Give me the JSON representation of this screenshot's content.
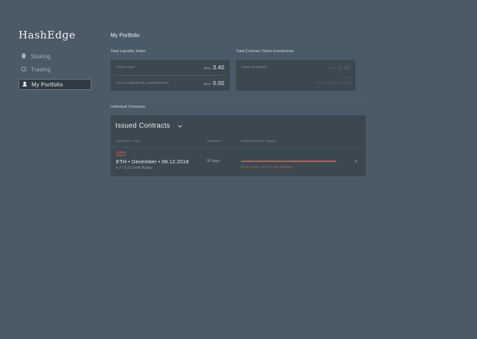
{
  "app": {
    "name": "HashEdge"
  },
  "nav": {
    "items": [
      {
        "label": "Staking",
        "icon": "document-icon"
      },
      {
        "label": "Trading",
        "icon": "globe-icon"
      },
      {
        "label": "My Portfolio",
        "icon": "user-icon",
        "active": true
      }
    ]
  },
  "page": {
    "title": "My Portfolio"
  },
  "liquidity": {
    "section_label": "Total Liquidity Stake",
    "rows": [
      {
        "label": "TOTAL STAKE",
        "currency": "ETH",
        "value": "3.40"
      },
      {
        "label": "TOTAL CUMULATIVE DIVIDENDS PAID",
        "currency": "ETH",
        "value": "0.00"
      }
    ]
  },
  "investments": {
    "section_label": "Total Contract Token Investments",
    "holdings_label": "TOTAL HOLDINGS",
    "currency": "ETH",
    "value": "0.00",
    "note_top": "HOLD",
    "note_bottom": "Collective staking at ETH Stake"
  },
  "contracts": {
    "section_label": "Individual Contracts",
    "dropdown_label": "Issued Contracts",
    "columns": [
      "CONTRACT TITLE",
      "MATURITY",
      "OPEN INTEREST STAKES"
    ],
    "rows": [
      {
        "badge": "NEW",
        "title": "ETH • December • 08.12.2018",
        "subtitle": "4.7 / 5.0 Credit Rating",
        "maturity": "30 days",
        "stake_text": "ETH 3.40 / ETH 3.40 Staked",
        "stake_fraction": 1.0
      }
    ]
  },
  "colors": {
    "accent": "#d7574a",
    "background": "#4a5a66",
    "card": "#3b4850"
  }
}
